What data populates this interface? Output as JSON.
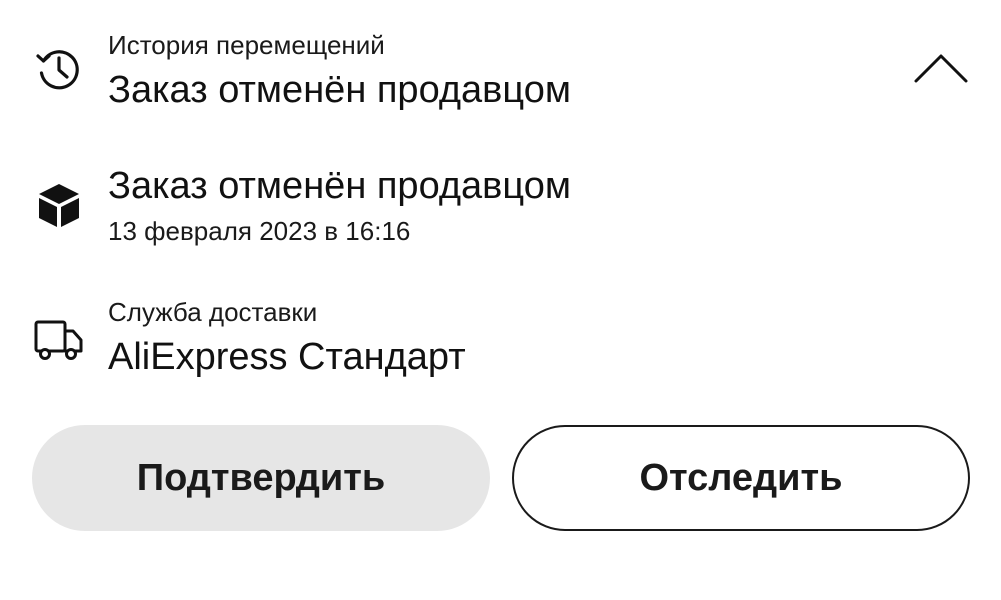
{
  "history": {
    "label": "История перемещений",
    "status": "Заказ отменён продавцом",
    "icon": "history-clock-icon",
    "toggle_icon": "chevron-up-icon"
  },
  "event": {
    "title": "Заказ отменён продавцом",
    "date": "13 февраля 2023 в 16:16",
    "icon": "package-box-icon"
  },
  "delivery": {
    "label": "Служба доставки",
    "service": "AliExpress Стандарт",
    "icon": "delivery-truck-icon"
  },
  "actions": {
    "confirm_label": "Подтвердить",
    "track_label": "Отследить"
  },
  "colors": {
    "text": "#111111",
    "confirm_bg": "#e6e6e6",
    "outline": "#1a1a1a"
  }
}
